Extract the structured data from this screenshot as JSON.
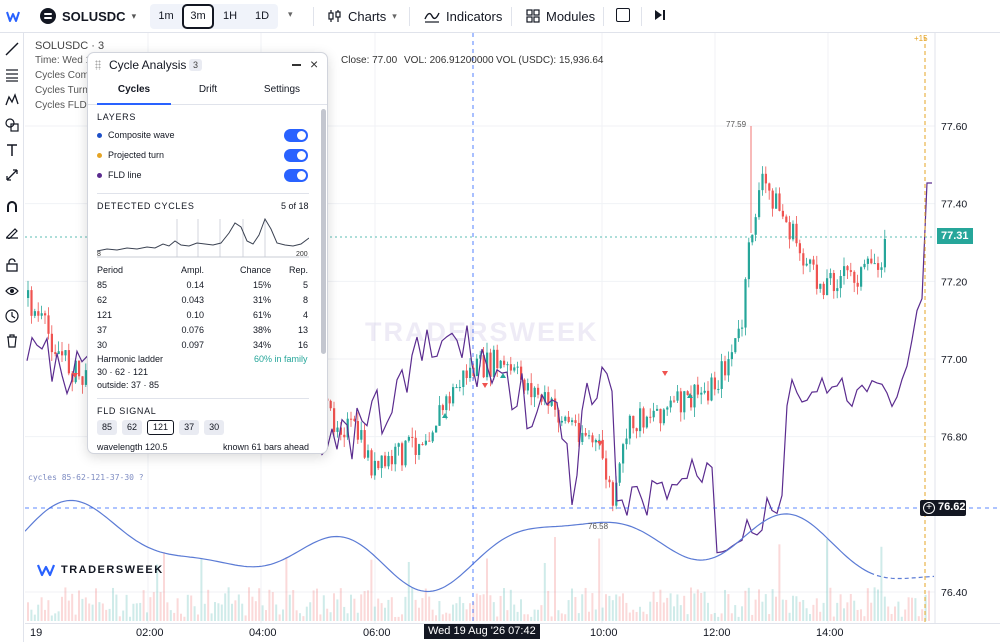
{
  "toolbar": {
    "symbol": "SOLUSDC",
    "timeframes": [
      {
        "label": "1m",
        "active": false
      },
      {
        "label": "3m",
        "active": true
      },
      {
        "label": "1H",
        "active": false
      },
      {
        "label": "1D",
        "active": false
      }
    ],
    "charts_label": "Charts",
    "indicators_label": "Indicators",
    "modules_label": "Modules"
  },
  "legend": {
    "title": "SOLUSDC · 3",
    "time": "Time: Wed 1",
    "rows": [
      "Cycles Comp",
      "Cycles Turns",
      "Cycles FLD"
    ],
    "close": "Close: 77.00",
    "vol": "VOL: 206.91200000",
    "vol_usdc": "VOL (USDC): 15,936.64"
  },
  "price_axis": {
    "ticks": [
      "77.60",
      "77.40",
      "77.20",
      "77.00",
      "76.80",
      "76.40"
    ],
    "last_price": "77.31",
    "crosshair_price": "76.62",
    "marker_top": "+15"
  },
  "time_axis": {
    "ticks": [
      "19",
      "02:00",
      "04:00",
      "06:00",
      "10:00",
      "12:00",
      "14:00"
    ],
    "crosshair_label": "Wed 19 Aug '26 07:42"
  },
  "annotations": {
    "high_label": "77.59",
    "low_label": "76.58"
  },
  "watermark": "TRADERSWEEK",
  "brand": "TRADERSWEEK",
  "cycles_note": "cycles 85-62-121-37-30 ?",
  "colors": {
    "up": "#26a69a",
    "down": "#ef5350",
    "fld": "#5b2c8f",
    "composite": "#5b7bd5",
    "accent": "#2962ff"
  },
  "panel": {
    "title": "Cycle Analysis",
    "count": "3",
    "tabs": [
      {
        "label": "Cycles",
        "active": true
      },
      {
        "label": "Drift",
        "active": false
      },
      {
        "label": "Settings",
        "active": false
      }
    ],
    "layers_title": "LAYERS",
    "layers": [
      {
        "label": "Composite wave",
        "dot": "#1e50c8",
        "on": true
      },
      {
        "label": "Projected turn",
        "dot": "#e5a424",
        "on": true
      },
      {
        "label": "FLD line",
        "dot": "#5b2c8f",
        "on": true
      }
    ],
    "detected_title": "DETECTED CYCLES",
    "detected_count": "5 of 18",
    "spectrum_min": "8",
    "spectrum_max": "200",
    "table_headers": [
      "Period",
      "Ampl.",
      "Chance",
      "Rep."
    ],
    "table_rows": [
      [
        "85",
        "0.14",
        "15%",
        "5"
      ],
      [
        "62",
        "0.043",
        "31%",
        "8"
      ],
      [
        "121",
        "0.10",
        "61%",
        "4"
      ],
      [
        "37",
        "0.076",
        "38%",
        "13"
      ],
      [
        "30",
        "0.097",
        "34%",
        "16"
      ]
    ],
    "harmonic_title": "Harmonic ladder",
    "harmonic_family": "60% in family",
    "harmonic_ladder": "30 · 62 · 121",
    "harmonic_outside": "outside: 37 · 85",
    "fld_title": "FLD SIGNAL",
    "fld_chips": [
      {
        "label": "85",
        "active": false
      },
      {
        "label": "62",
        "active": false
      },
      {
        "label": "121",
        "active": true
      },
      {
        "label": "37",
        "active": false
      },
      {
        "label": "30",
        "active": false
      }
    ],
    "wavelength": "wavelength 120.5",
    "known": "known 61 bars ahead"
  }
}
